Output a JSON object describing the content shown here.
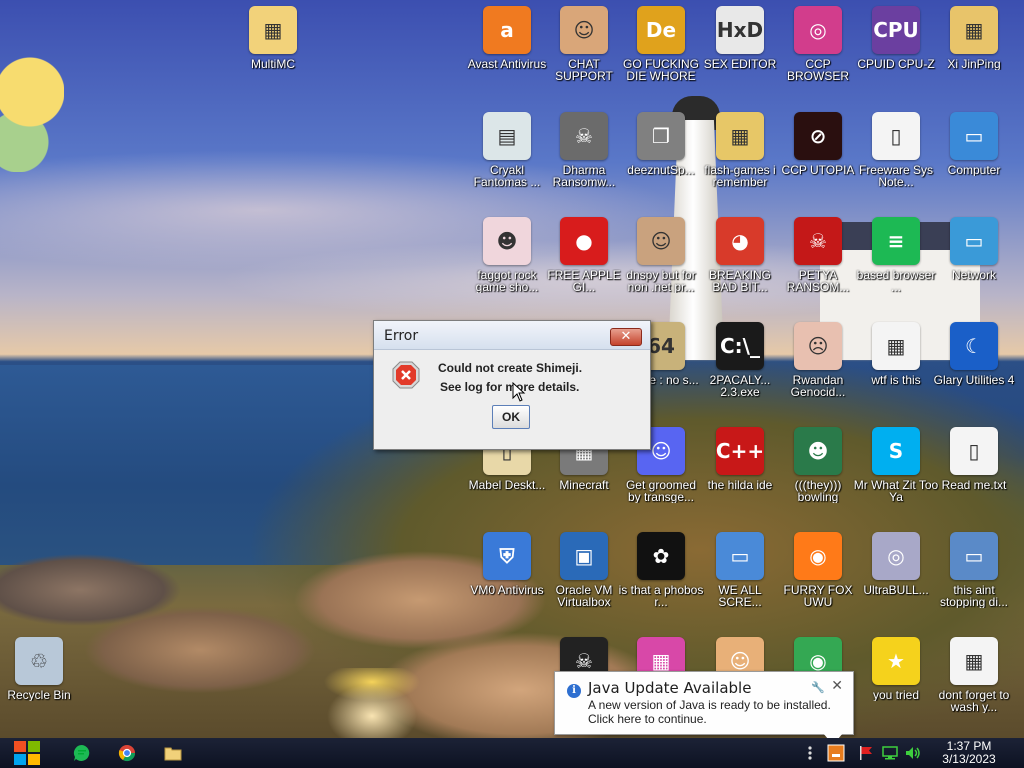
{
  "desktop": {
    "icons": [
      {
        "id": "multimc",
        "label": "MultiMC",
        "color": "#f2d27a",
        "glyph": "▦"
      },
      {
        "id": "avast",
        "label": "Avast Antivirus",
        "color": "#f07a20",
        "glyph": "a"
      },
      {
        "id": "chat",
        "label": "CHAT SUPPORT",
        "color": "#d9a679",
        "glyph": "☺"
      },
      {
        "id": "gofd",
        "label": "GO FUCKING DIE WHORE",
        "color": "#e0a21c",
        "glyph": "De"
      },
      {
        "id": "hxd",
        "label": "SEX EDITOR",
        "color": "#e8e8e8",
        "glyph": "HxD"
      },
      {
        "id": "ccp",
        "label": "CCP BROWSER",
        "color": "#d23d8c",
        "glyph": "◎"
      },
      {
        "id": "cpuz",
        "label": "CPUID CPU-Z",
        "color": "#6b3fa0",
        "glyph": "CPU"
      },
      {
        "id": "xi",
        "label": "Xi JinPing",
        "color": "#e8c46a",
        "glyph": "▦"
      },
      {
        "id": "cryakl",
        "label": "Cryakl Fantomas ...",
        "color": "#dce6e8",
        "glyph": "▤"
      },
      {
        "id": "dharma",
        "label": "Dharma Ransomw...",
        "color": "#6b6b6b",
        "glyph": "☠"
      },
      {
        "id": "deez",
        "label": "deeznutSp...",
        "color": "#808080",
        "glyph": "❐"
      },
      {
        "id": "flash",
        "label": "flash-games i remember",
        "color": "#e7c767",
        "glyph": "▦"
      },
      {
        "id": "utopia",
        "label": "CCP UTOPIA",
        "color": "#2a0f0f",
        "glyph": "⊘"
      },
      {
        "id": "freeware",
        "label": "Freeware Sys Note...",
        "color": "#f4f4f4",
        "glyph": "▯"
      },
      {
        "id": "computer",
        "label": "Computer",
        "color": "#3a8ad8",
        "glyph": "▭"
      },
      {
        "id": "faggot",
        "label": "faggot rock game sho...",
        "color": "#f0d6dc",
        "glyph": "☻"
      },
      {
        "id": "apple",
        "label": "FREE APPLE GI...",
        "color": "#d81c1c",
        "glyph": "●"
      },
      {
        "id": "dnspy",
        "label": "dnspy but for non .net pr...",
        "color": "#c9a27e",
        "glyph": "☺"
      },
      {
        "id": "bbad",
        "label": "BREAKING BAD BIT...",
        "color": "#d83a2a",
        "glyph": "◕"
      },
      {
        "id": "petya",
        "label": "PETYA RANSOM...",
        "color": "#c41818",
        "glyph": "☠"
      },
      {
        "id": "based",
        "label": "based browser ...",
        "color": "#1db954",
        "glyph": "≡"
      },
      {
        "id": "network",
        "label": "Network",
        "color": "#3a9ad8",
        "glyph": "▭"
      },
      {
        "id": "above",
        "label": "above : no s...",
        "color": "#c8b27a",
        "glyph": "64"
      },
      {
        "id": "2pac",
        "label": "2PACALY... 2.3.exe",
        "color": "#1a1a1a",
        "glyph": "C:\\_"
      },
      {
        "id": "rwanda",
        "label": "Rwandan Genocid...",
        "color": "#e8c0b0",
        "glyph": "☹"
      },
      {
        "id": "wtf",
        "label": "wtf is this",
        "color": "#f4f4f4",
        "glyph": "▦"
      },
      {
        "id": "glary",
        "label": "Glary Utilities 4",
        "color": "#1a5fc8",
        "glyph": "☾"
      },
      {
        "id": "mabel",
        "label": "Mabel Deskt...",
        "color": "#e8d8a8",
        "glyph": "▯"
      },
      {
        "id": "minecraft",
        "label": "Minecraft",
        "color": "#7a7a7a",
        "glyph": "▦"
      },
      {
        "id": "groomed",
        "label": "Get groomed by transge...",
        "color": "#5865f2",
        "glyph": "☺"
      },
      {
        "id": "devcpp",
        "label": "the hilda ide",
        "color": "#c81818",
        "glyph": "C++"
      },
      {
        "id": "bowling",
        "label": "(((they))) bowling",
        "color": "#2a7a4a",
        "glyph": "☻"
      },
      {
        "id": "skype",
        "label": "Mr What Zit Too Ya",
        "color": "#00aff0",
        "glyph": "S"
      },
      {
        "id": "readme",
        "label": "Read me.txt",
        "color": "#f4f4f4",
        "glyph": "▯"
      },
      {
        "id": "vmo",
        "label": "VM0 Antivirus",
        "color": "#3a7ad8",
        "glyph": "⛨"
      },
      {
        "id": "vbox",
        "label": "Oracle VM Virtualbox",
        "color": "#2a6ab8",
        "glyph": "▣"
      },
      {
        "id": "phobos",
        "label": "is that a phobos r...",
        "color": "#111111",
        "glyph": "✿"
      },
      {
        "id": "weall",
        "label": "WE ALL SCRE...",
        "color": "#4a8ad8",
        "glyph": "▭"
      },
      {
        "id": "firefox",
        "label": "FURRY FOX UWU",
        "color": "#ff7a18",
        "glyph": "◉"
      },
      {
        "id": "ultrabull",
        "label": "UltraBULL...",
        "color": "#a8a8c8",
        "glyph": "◎"
      },
      {
        "id": "stopping",
        "label": "this aint stopping di...",
        "color": "#5a8ac8",
        "glyph": "▭"
      },
      {
        "id": "recycle",
        "label": "Recycle Bin",
        "color": "#b8c8d8",
        "glyph": "♲"
      },
      {
        "id": "skull",
        "label": "",
        "color": "#222222",
        "glyph": "☠"
      },
      {
        "id": "pink",
        "label": "",
        "color": "#d848a8",
        "glyph": "▦"
      },
      {
        "id": "hank",
        "label": "",
        "color": "#e8b078",
        "glyph": "☺"
      },
      {
        "id": "chrome",
        "label": "",
        "color": "#34a853",
        "glyph": "◉"
      },
      {
        "id": "tried",
        "label": "you tried",
        "color": "#f5d21c",
        "glyph": "★"
      },
      {
        "id": "wash",
        "label": "dont forget to wash y...",
        "color": "#f4f4f4",
        "glyph": "▦"
      }
    ]
  },
  "dialog": {
    "title": "Error",
    "close": "✕",
    "line1": "Could not create Shimeji.",
    "line2": "See log for more details.",
    "ok": "OK"
  },
  "toast": {
    "title": "Java Update Available",
    "body1": "A new version of Java is ready to be installed.",
    "body2": "Click here to continue.",
    "info": "i",
    "close": "✕",
    "tool": "🔧"
  },
  "taskbar": {
    "time": "1:37 PM",
    "date": "3/13/2023"
  }
}
